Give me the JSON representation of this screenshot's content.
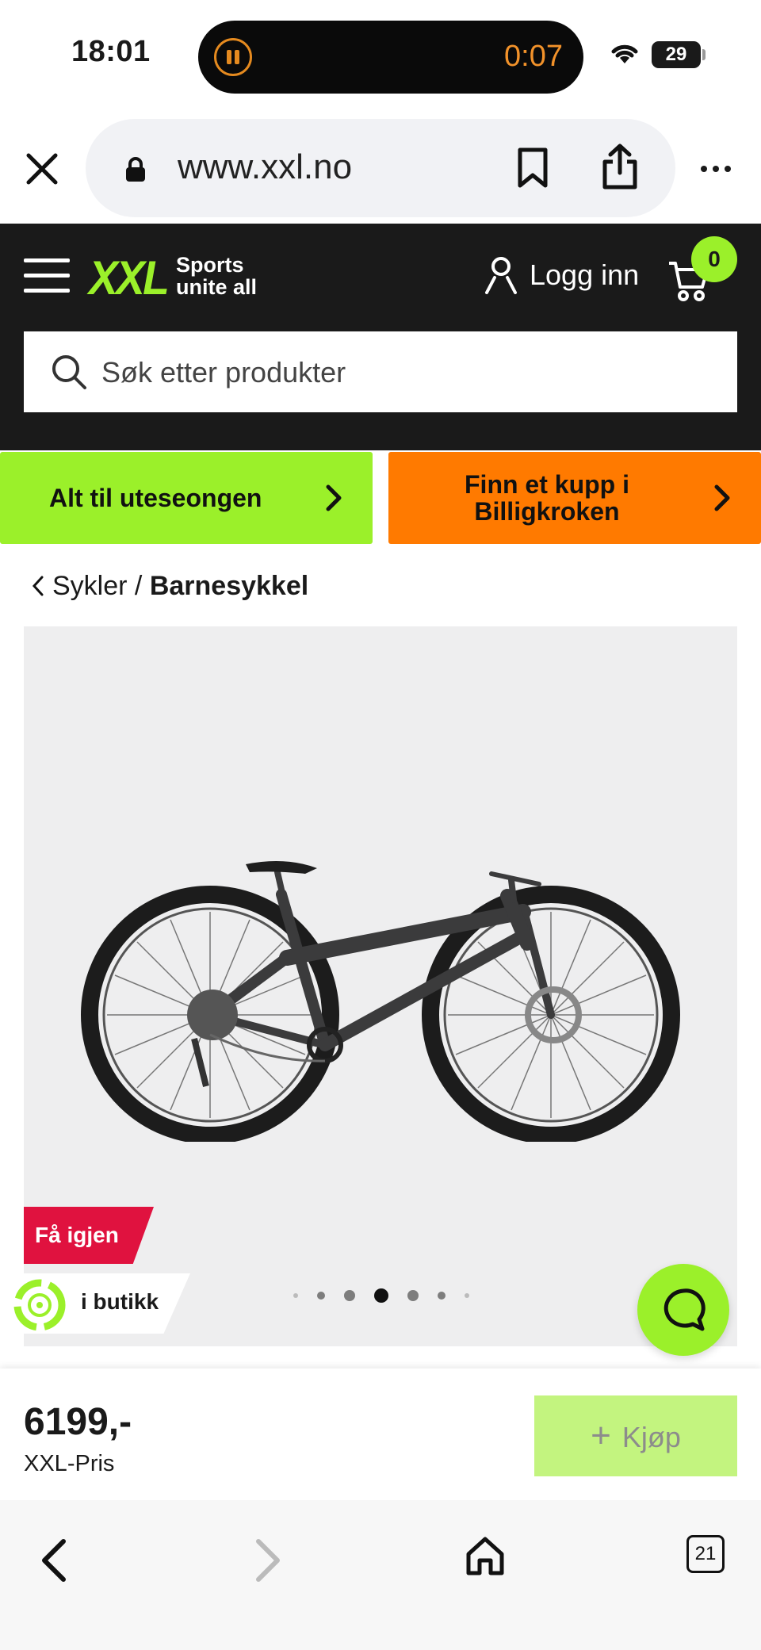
{
  "status": {
    "time": "18:01",
    "recording_timer": "0:07",
    "battery": "29"
  },
  "browser": {
    "url": "www.xxl.no",
    "tab_count": "21"
  },
  "site": {
    "logo": "XXL",
    "tagline_line1": "Sports",
    "tagline_line2": "unite all",
    "login_label": "Logg inn",
    "cart_count": "0",
    "search_placeholder": "Søk etter produkter"
  },
  "promos": [
    {
      "line1": "Alt til uteseongen",
      "line2": ""
    },
    {
      "line1": "Finn et kupp i",
      "line2": "Billigkroken"
    }
  ],
  "breadcrumb": {
    "parent": "Sykler",
    "separator": "/",
    "current": "Barnesykkel"
  },
  "gallery": {
    "badge_again": "Få igjen",
    "badge_store": "i butikk",
    "active_dot": 3,
    "dot_count": 7
  },
  "product": {
    "price": "6199,-",
    "price_label": "XXL-Pris",
    "buy_label": "Kjøp"
  },
  "colors": {
    "brand_green": "#9bf02a",
    "brand_orange": "#ff7a00",
    "header_bg": "#1a1a1a",
    "sale_red": "#e0123f"
  }
}
